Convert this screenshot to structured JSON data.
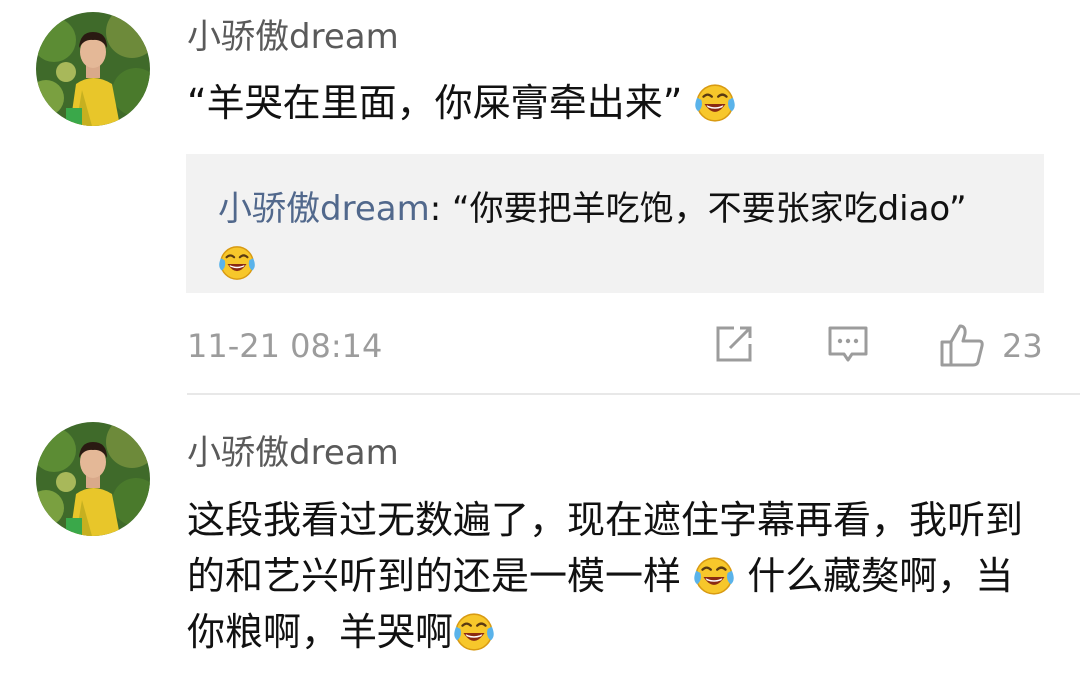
{
  "comments": [
    {
      "username": "小骄傲dream",
      "text": "“羊哭在里面，你屎膏牵出来”",
      "emoji": "laughing-tears-emoji",
      "reply": {
        "username": "小骄傲dream",
        "separator": ": ",
        "text": "“你要把羊吃饱，不要张家吃diao”",
        "emoji": "laughing-tears-emoji"
      },
      "timestamp": "11-21 08:14",
      "actions": {
        "share_icon": "share-icon",
        "reply_icon": "comment-icon",
        "like_icon": "thumbs-up-icon",
        "like_count": "23"
      }
    },
    {
      "username": "小骄傲dream",
      "text_part1": "这段我看过无数遍了，现在遮住字幕再看，我听到的和艺兴听到的还是一模一样",
      "text_part2": "  什么藏獒啊，当你粮啊，羊哭啊",
      "emojis": [
        "laughing-tears-emoji",
        "laughing-tears-emoji"
      ]
    }
  ],
  "colors": {
    "username": "#5a5a5a",
    "reply_username": "#51688c",
    "reply_background": "#f2f2f2",
    "meta_text": "#9c9c9c",
    "emoji_face": "#f7c72b",
    "emoji_tear": "#5ab3ea"
  }
}
